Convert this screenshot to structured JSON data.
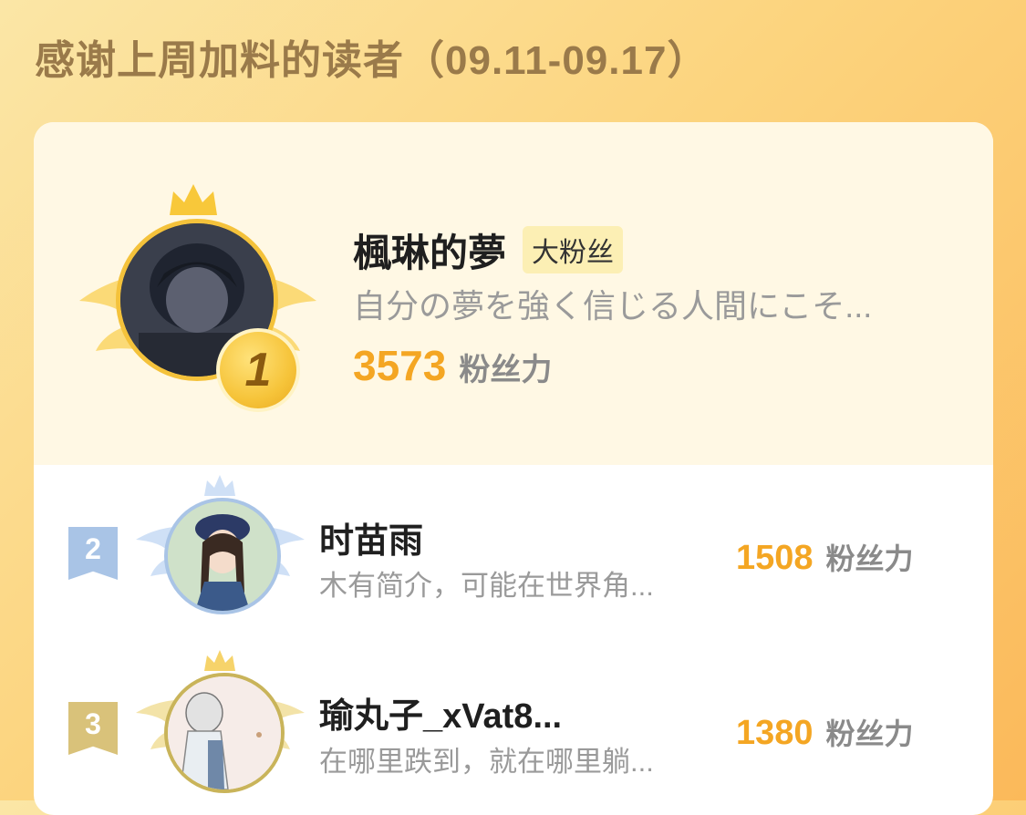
{
  "page": {
    "title": "感谢上周加料的读者（09.11-09.17）"
  },
  "top_reader": {
    "rank": "1",
    "name": "楓琳的夢",
    "badge": "大粉丝",
    "bio": "自分の夢を強く信じる人間にこそ...",
    "score": "3573",
    "score_label": "粉丝力"
  },
  "readers": [
    {
      "rank": "2",
      "name": "时苗雨",
      "bio": "木有简介，可能在世界角...",
      "score": "1508",
      "score_label": "粉丝力"
    },
    {
      "rank": "3",
      "name": "瑜丸子_xVat8...",
      "bio": "在哪里跌到，就在哪里躺...",
      "score": "1380",
      "score_label": "粉丝力"
    }
  ],
  "colors": {
    "accent": "#f4a623",
    "title": "#9a7a4a",
    "gold": "#f6c43a",
    "silver": "#a9c4e6",
    "bronze": "#d9c27a"
  },
  "icons": [
    "crown-icon",
    "wing-icon",
    "rank-medal-icon",
    "rank-ribbon-icon"
  ]
}
